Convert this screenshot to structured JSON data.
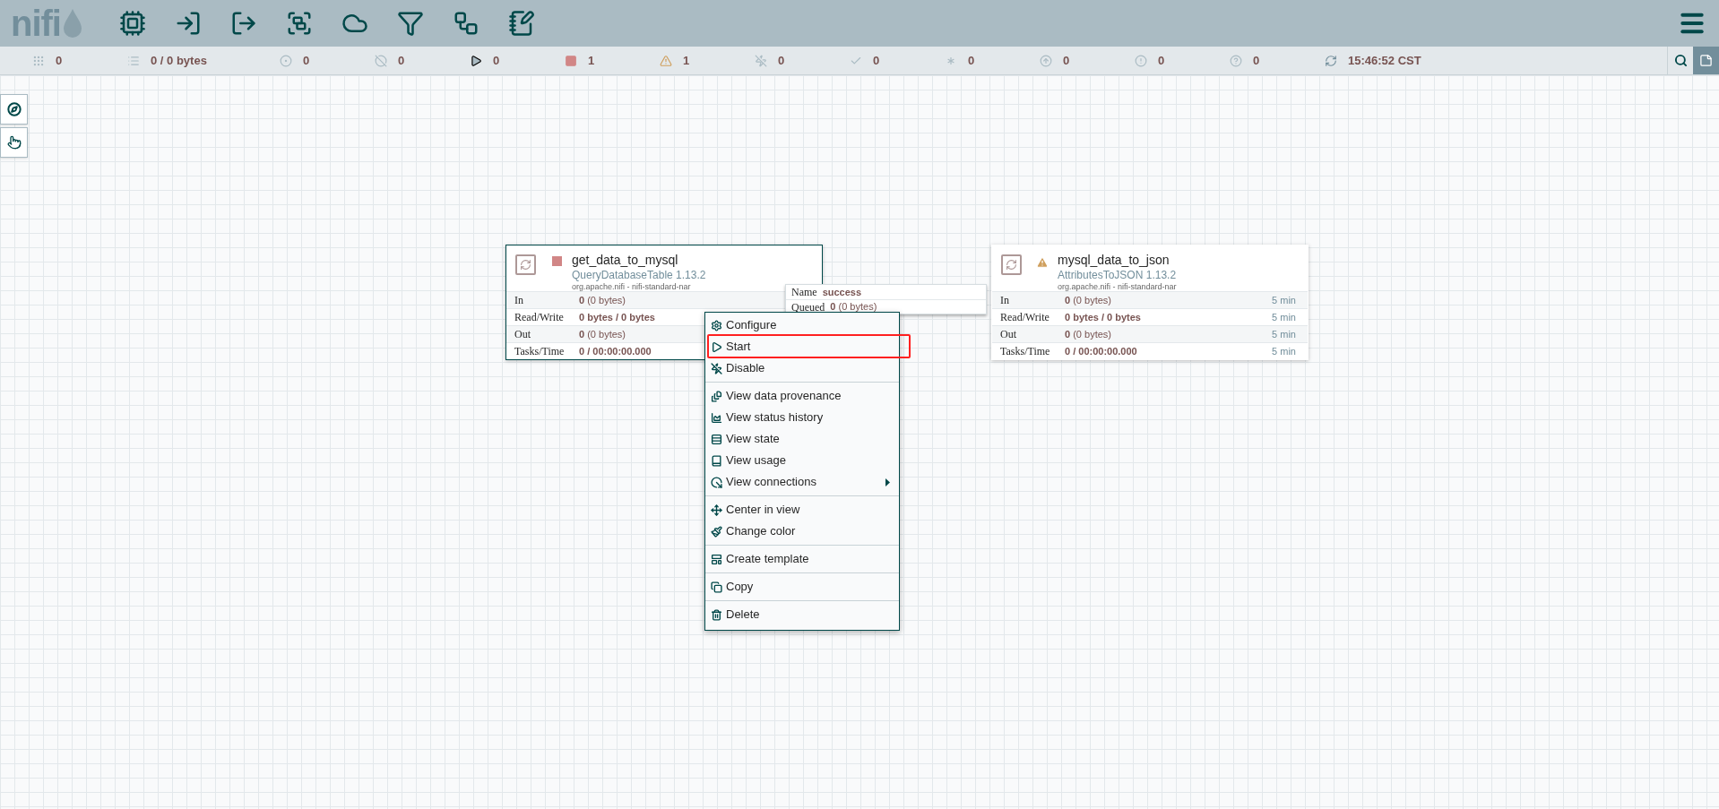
{
  "header": {
    "logo": "nifi"
  },
  "status_bar": {
    "items": [
      {
        "value": "0"
      },
      {
        "value": "0 / 0 bytes"
      },
      {
        "value": "0"
      },
      {
        "value": "0"
      },
      {
        "value": "0"
      },
      {
        "value": "1"
      },
      {
        "value": "1"
      },
      {
        "value": "0"
      },
      {
        "value": "0"
      },
      {
        "value": "0"
      },
      {
        "value": "0"
      },
      {
        "value": "0"
      },
      {
        "value": "0"
      },
      {
        "value": "15:46:52 CST"
      }
    ]
  },
  "processors": [
    {
      "name": "get_data_to_mysql",
      "type": "QueryDatabaseTable 1.13.2",
      "bundle": "org.apache.nifi - nifi-standard-nar",
      "kind": "stopped",
      "selected": true,
      "rows": [
        {
          "label": "In",
          "value": "**0** (0 bytes)",
          "bold": false
        },
        {
          "label": "Read/Write",
          "value": "0 bytes / 0 bytes",
          "bold": true
        },
        {
          "label": "Out",
          "value": "**0** (0 bytes)",
          "bold": false
        },
        {
          "label": "Tasks/Time",
          "value": "0 / 00:00:00.000",
          "bold": true
        }
      ]
    },
    {
      "name": "mysql_data_to_json",
      "type": "AttributesToJSON 1.13.2",
      "bundle": "org.apache.nifi - nifi-standard-nar",
      "kind": "invalid",
      "selected": false,
      "rows": [
        {
          "label": "In",
          "value": "**0** (0 bytes)",
          "bold": false,
          "time": "5 min"
        },
        {
          "label": "Read/Write",
          "value": "0 bytes / 0 bytes",
          "bold": true,
          "time": "5 min"
        },
        {
          "label": "Out",
          "value": "**0** (0 bytes)",
          "bold": false,
          "time": "5 min"
        },
        {
          "label": "Tasks/Time",
          "value": "0 / 00:00:00.000",
          "bold": true,
          "time": "5 min"
        }
      ]
    }
  ],
  "connection_tooltip": {
    "rows": [
      {
        "label": "Name",
        "value": "success"
      },
      {
        "label": "Queued",
        "value": "**0** (0 bytes)"
      }
    ]
  },
  "context_menu": {
    "groups": [
      [
        {
          "label": "Configure",
          "highlighted": false,
          "submenu": false
        },
        {
          "label": "Start",
          "highlighted": true,
          "submenu": false
        },
        {
          "label": "Disable",
          "highlighted": false,
          "submenu": false
        }
      ],
      [
        {
          "label": "View data provenance",
          "highlighted": false,
          "submenu": false
        },
        {
          "label": "View status history",
          "highlighted": false,
          "submenu": false
        },
        {
          "label": "View state",
          "highlighted": false,
          "submenu": false
        },
        {
          "label": "View usage",
          "highlighted": false,
          "submenu": false
        },
        {
          "label": "View connections",
          "highlighted": false,
          "submenu": true
        }
      ],
      [
        {
          "label": "Center in view",
          "highlighted": false,
          "submenu": false
        },
        {
          "label": "Change color",
          "highlighted": false,
          "submenu": false
        }
      ],
      [
        {
          "label": "Create template",
          "highlighted": false,
          "submenu": false
        }
      ],
      [
        {
          "label": "Copy",
          "highlighted": false,
          "submenu": false
        }
      ],
      [
        {
          "label": "Delete",
          "highlighted": false,
          "submenu": false
        }
      ]
    ]
  }
}
